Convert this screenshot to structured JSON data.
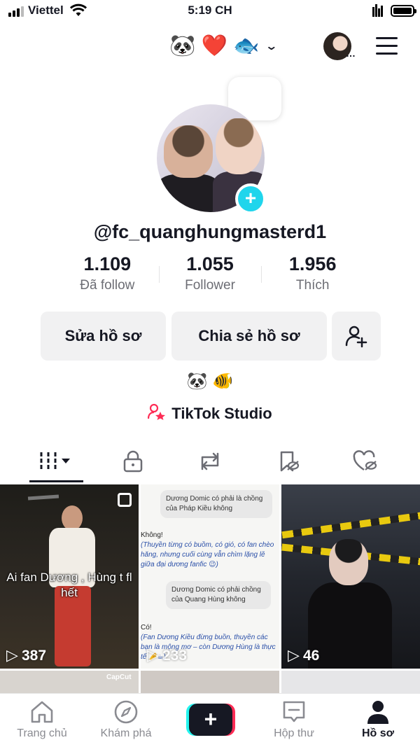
{
  "status_bar": {
    "carrier": "Viettel",
    "time": "5:19 CH"
  },
  "header": {
    "emoji_name": "🐼 ❤️ 🐟"
  },
  "profile": {
    "username": "@fc_quanghungmasterd1",
    "stats": [
      {
        "value": "1.109",
        "label": "Đã follow"
      },
      {
        "value": "1.055",
        "label": "Follower"
      },
      {
        "value": "1.956",
        "label": "Thích"
      }
    ],
    "buttons": {
      "edit": "Sửa hồ sơ",
      "share": "Chia sẻ hồ sơ"
    },
    "bio": "🐼 🐠",
    "studio_label": "TikTok Studio"
  },
  "videos": [
    {
      "caption": "Ai fan Dương , Hùng t fl hết",
      "views": "387"
    },
    {
      "views": "233",
      "chat": {
        "q1": "Dương Domic có phải là chồng của Pháp Kiều không",
        "a1_head": "Không!",
        "a1_body": "(Thuyền từng có buồm, có gió, có fan chèo hăng, nhưng cuối cùng vẫn chìm lặng lẽ giữa đại dương fanfic 😉)",
        "q2": "Dương Domic có phải chồng của Quang Hùng không",
        "a2_head": "Có!",
        "a2_body": "(Fan Dương Kiều đừng buồn, thuyền các bạn là mộng mơ – còn Dương Hùng là thực tế 🤌☕)"
      }
    },
    {
      "views": "46"
    }
  ],
  "row2_watermark": "CapCut",
  "bottom_nav": [
    {
      "label": "Trang chủ"
    },
    {
      "label": "Khám phá"
    },
    {
      "label": "Hộp thư"
    },
    {
      "label": "Hồ sơ"
    }
  ],
  "colors": {
    "accent_cyan": "#25f4ee",
    "accent_red": "#fe2c55",
    "badge": "#20d5ec"
  }
}
